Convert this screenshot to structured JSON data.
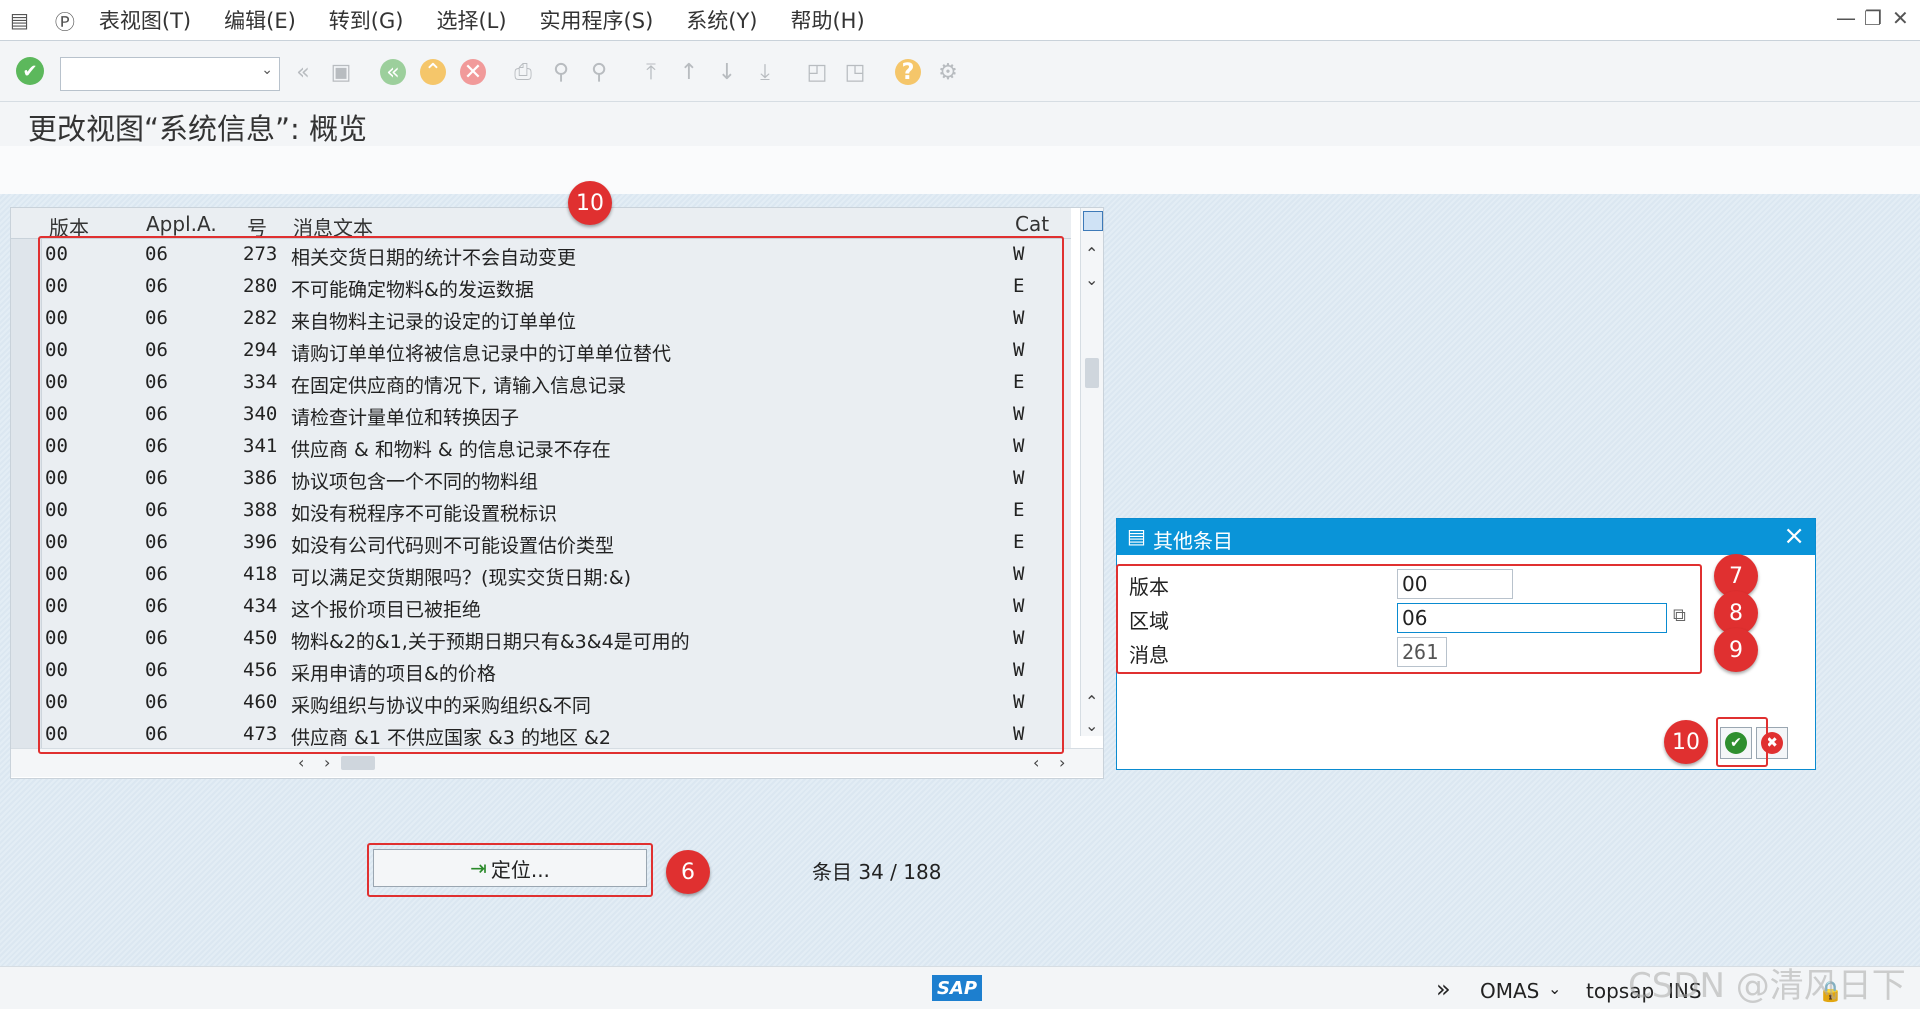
{
  "menu": {
    "items": [
      "表视图(T)",
      "编辑(E)",
      "转到(G)",
      "选择(L)",
      "实用程序(S)",
      "系统(Y)",
      "帮助(H)"
    ]
  },
  "window_controls": {
    "minimize": "—",
    "restore": "❐",
    "close": "✕"
  },
  "toolbar": {
    "icons": [
      "enter-icon",
      "command-field",
      "back-nav-icon",
      "save-icon",
      "back-icon",
      "exit-icon",
      "cancel-icon",
      "print-icon",
      "find-icon",
      "find-next-icon",
      "first-page-icon",
      "previous-page-icon",
      "next-page-icon",
      "last-page-icon",
      "create-session-icon",
      "shortcut-icon",
      "help-icon",
      "settings-icon"
    ]
  },
  "page": {
    "title": "更改视图“系统信息”: 概览"
  },
  "table": {
    "columns": [
      "版本",
      "Appl.A.",
      "号",
      "消息文本",
      "Cat"
    ],
    "rows": [
      [
        "00",
        "06",
        "273",
        "相关交货日期的统计不会自动变更",
        "W"
      ],
      [
        "00",
        "06",
        "280",
        "不可能确定物料&的发运数据",
        "E"
      ],
      [
        "00",
        "06",
        "282",
        "来自物料主记录的设定的订单单位",
        "W"
      ],
      [
        "00",
        "06",
        "294",
        "请购订单单位将被信息记录中的订单单位替代",
        "W"
      ],
      [
        "00",
        "06",
        "334",
        "在固定供应商的情况下, 请输入信息记录",
        "E"
      ],
      [
        "00",
        "06",
        "340",
        "请检查计量单位和转换因子",
        "W"
      ],
      [
        "00",
        "06",
        "341",
        "供应商 & 和物料 & 的信息记录不存在",
        "W"
      ],
      [
        "00",
        "06",
        "386",
        "协议项包含一个不同的物料组",
        "W"
      ],
      [
        "00",
        "06",
        "388",
        "如没有税程序不可能设置税标识",
        "E"
      ],
      [
        "00",
        "06",
        "396",
        "如没有公司代码则不可能设置估价类型",
        "E"
      ],
      [
        "00",
        "06",
        "418",
        "可以满足交货期限吗？(现实交货日期:&)",
        "W"
      ],
      [
        "00",
        "06",
        "434",
        "这个报价项目已被拒绝",
        "W"
      ],
      [
        "00",
        "06",
        "450",
        "物料&2的&1,关于预期日期只有&3&4是可用的",
        "W"
      ],
      [
        "00",
        "06",
        "456",
        "采用申请的项目&的价格",
        "W"
      ],
      [
        "00",
        "06",
        "460",
        "采购组织与协议中的采购组织&不同",
        "W"
      ],
      [
        "00",
        "06",
        "473",
        "供应商 &1 不供应国家 &3 的地区 &2",
        "W"
      ]
    ]
  },
  "position_button": {
    "label": "定位..."
  },
  "entries": {
    "text": "条目 34 / 188"
  },
  "dialog": {
    "title": "其他条目",
    "fields": [
      {
        "label": "版本",
        "value": "00"
      },
      {
        "label": "区域",
        "value": "06"
      },
      {
        "label": "消息",
        "value": "261"
      }
    ],
    "confirm": "✔",
    "cancel": "✖"
  },
  "badges": {
    "table": "10",
    "version": "7",
    "area": "8",
    "message": "9",
    "confirm": "10",
    "position": "6"
  },
  "status": {
    "system": "OMAS",
    "server": "topsap",
    "mode": "INS",
    "logo": "SAP"
  },
  "watermark": "CSDN @清风日下",
  "colors": {
    "dialog_header": "#0a94d8",
    "highlight": "#e03030",
    "row_bg": "#eaeef2"
  }
}
